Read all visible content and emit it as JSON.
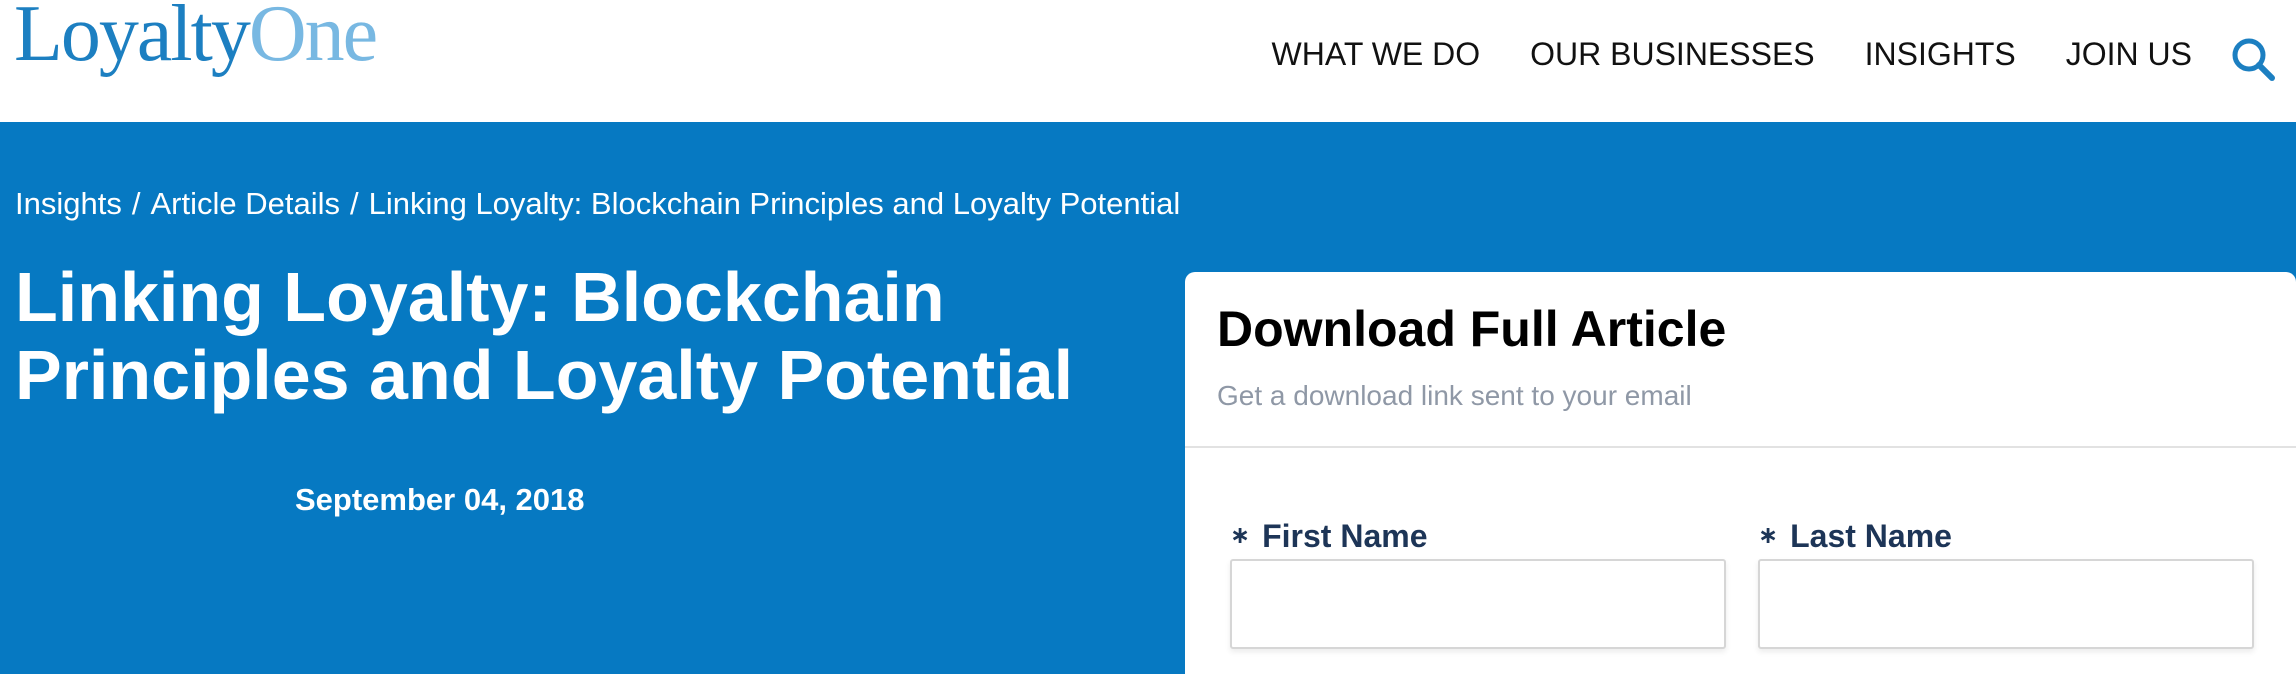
{
  "header": {
    "logo": {
      "part1": "Loyalty",
      "part2": "One"
    },
    "nav": [
      {
        "label": "WHAT WE DO"
      },
      {
        "label": "OUR BUSINESSES"
      },
      {
        "label": "INSIGHTS"
      },
      {
        "label": "JOIN US"
      }
    ],
    "search_icon": "search-icon",
    "accent_color": "#1c7fc1"
  },
  "hero": {
    "background_color": "#0679c2",
    "breadcrumb": [
      {
        "label": "Insights"
      },
      {
        "label": "Article Details"
      },
      {
        "label": "Linking Loyalty: Blockchain Principles and Loyalty Potential"
      }
    ],
    "breadcrumb_separator": "/",
    "title": "Linking Loyalty: Blockchain Principles and Loyalty Potential",
    "date": "September 04, 2018"
  },
  "form": {
    "title": "Download Full Article",
    "subtitle": "Get a download link sent to your email",
    "required_marker": "∗",
    "first_name": {
      "label": "First Name",
      "value": ""
    },
    "last_name": {
      "label": "Last Name",
      "value": ""
    }
  }
}
